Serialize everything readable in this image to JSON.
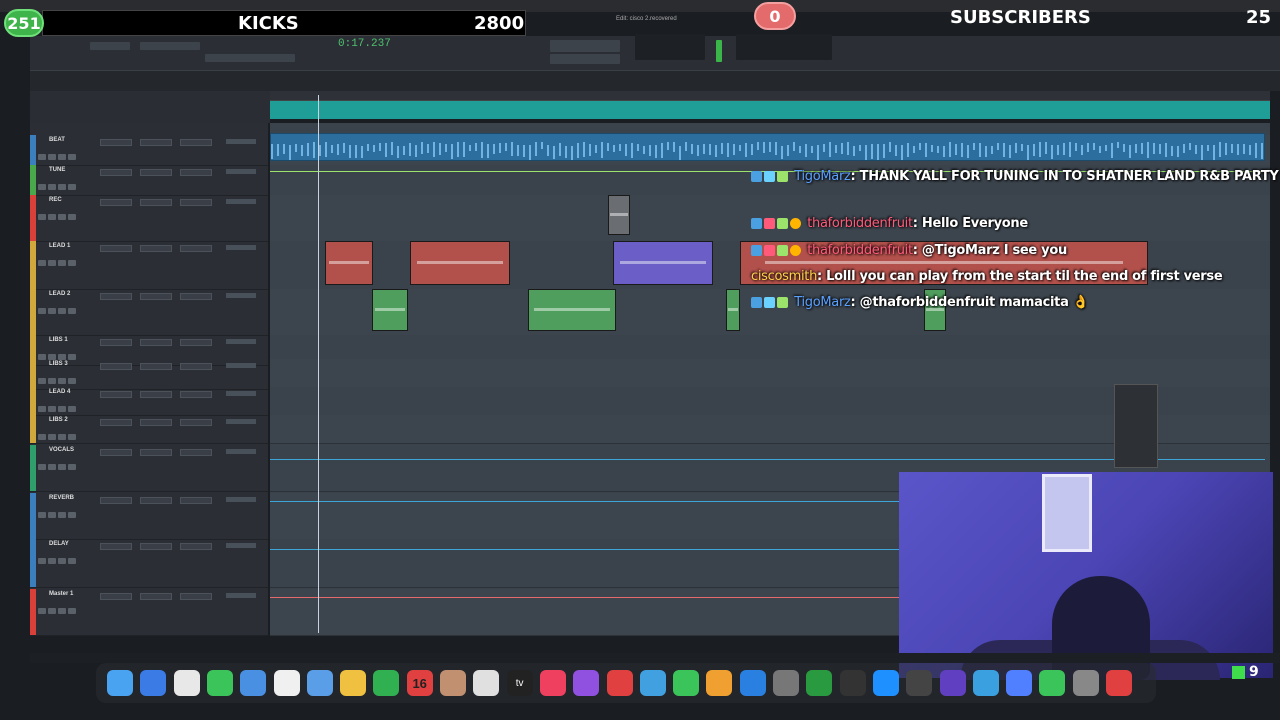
{
  "stream": {
    "kicks_count": "251",
    "kicks_label": "KICKS",
    "kicks_goal": "2800",
    "subs_count": "0",
    "subs_label": "SUBSCRIBERS",
    "subs_goal": "25",
    "webcam_kick_count": "9"
  },
  "protools": {
    "window_title": "Edit: cisco 2.recovered",
    "main_counter": "0:17.237",
    "tracks": [
      {
        "name": "BEAT",
        "color": "#3c7fbf"
      },
      {
        "name": "TUNE",
        "color": "#4aa84c"
      },
      {
        "name": "REC",
        "color": "#d9403a"
      },
      {
        "name": "LEAD 1",
        "color": "#d0a83b"
      },
      {
        "name": "LEAD 2",
        "color": "#d0a83b"
      },
      {
        "name": "LIBS 1",
        "color": "#d0a83b"
      },
      {
        "name": "LIBS 3",
        "color": "#d0a83b"
      },
      {
        "name": "LEAD 4",
        "color": "#d0a83b"
      },
      {
        "name": "LIBS 2",
        "color": "#d0a83b"
      },
      {
        "name": "VOCALS",
        "color": "#2f9e6a"
      },
      {
        "name": "REVERB",
        "color": "#3c7fbf"
      },
      {
        "name": "DELAY",
        "color": "#3c7fbf"
      },
      {
        "name": "Master 1",
        "color": "#d9403a"
      }
    ]
  },
  "chat": [
    {
      "user": "TigoMarz",
      "message": ": THANK YALL FOR TUNING IN TO SHATNER LAND R&B PARTY",
      "user_color": "#5aa0ff"
    },
    {
      "user": "thaforbiddenfruit",
      "message": ": Hello Everyone",
      "user_color": "#ff5a7a"
    },
    {
      "user": "thaforbiddenfruit",
      "message": ": @TigoMarz I see you",
      "user_color": "#ff5a7a"
    },
    {
      "user": "ciscosmith",
      "message": ": Lolll you can play from the start til the end of first verse",
      "user_color": "#ffd24a"
    },
    {
      "user": "TigoMarz",
      "message": ": @thaforbiddenfruit mamacita",
      "user_color": "#5aa0ff"
    }
  ],
  "dock": {
    "calendar_day": "16",
    "tv_label": "tv"
  }
}
